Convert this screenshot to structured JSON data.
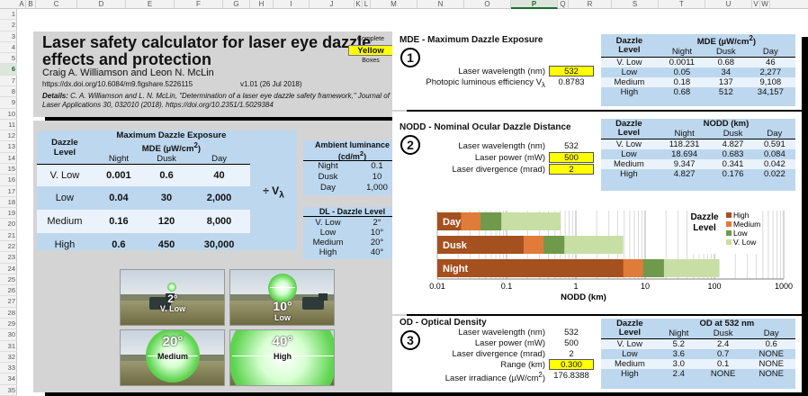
{
  "columns": [
    "A",
    "B",
    "C",
    "D",
    "E",
    "F",
    "G",
    "H",
    "I",
    "J",
    "K",
    "L",
    "M",
    "N",
    "O",
    "P",
    "Q",
    "R",
    "S",
    "T",
    "U",
    "V",
    "W"
  ],
  "selected_column": "P",
  "selected_row": "6",
  "rows": [
    "1",
    "2",
    "3",
    "4",
    "5",
    "6",
    "7",
    "8",
    "9",
    "10",
    "11",
    "12",
    "13",
    "14",
    "15",
    "16",
    "17",
    "18",
    "19",
    "20",
    "21",
    "22",
    "23",
    "24",
    "25",
    "26",
    "27",
    "28",
    "29",
    "30",
    "31",
    "32",
    "33",
    "34",
    "35"
  ],
  "header": {
    "title_line1": "Laser safety calculator for laser eye dazzle",
    "title_line2": "effects and protection",
    "authors": "Craig A. Williamson and Leon N. McLin",
    "doi": "https://dx.doi.org/10.6084/m9.figshare.5226115",
    "version": "v1.01 (26 Jul 2018)",
    "complete_label": "Complete",
    "yellow_label": "Yellow",
    "boxes_label": "Boxes",
    "details_label": "Details:",
    "details_text": " C. A. Williamson and L. N. McLin, \"Determination of a laser eye dazzle safety framework,\" Journal of Laser Applications 30, 032010 (2018). https://doi.org/10.2351/1.5029384"
  },
  "mde_table": {
    "col_dazzle": "Dazzle",
    "col_level": "Level",
    "title_line1": "Maximum Dazzle Exposure",
    "title_line2": "MDE (µW/cm",
    "title_sup": "2",
    "title_close": ")",
    "night": "Night",
    "dusk": "Dusk",
    "day": "Day",
    "rows": [
      {
        "level": "V. Low",
        "night": "0.001",
        "dusk": "0.6",
        "day": "40"
      },
      {
        "level": "Low",
        "night": "0.04",
        "dusk": "30",
        "day": "2,000"
      },
      {
        "level": "Medium",
        "night": "0.16",
        "dusk": "120",
        "day": "8,000"
      },
      {
        "level": "High",
        "night": "0.6",
        "dusk": "450",
        "day": "30,000"
      }
    ],
    "divide": "÷ V",
    "divide_sub": "λ"
  },
  "ambient": {
    "title": "Ambient luminance",
    "unit": "(cd/m",
    "unit_sup": "2",
    "unit_close": ")",
    "rows": [
      {
        "name": "Night",
        "value": "0.1"
      },
      {
        "name": "Dusk",
        "value": "10"
      },
      {
        "name": "Day",
        "value": "1,000"
      }
    ]
  },
  "dl": {
    "title": "DL - Dazzle Level",
    "rows": [
      {
        "name": "V. Low",
        "value": "2°"
      },
      {
        "name": "Low",
        "value": "10°"
      },
      {
        "name": "Medium",
        "value": "20°"
      },
      {
        "name": "High",
        "value": "40°"
      }
    ]
  },
  "photos": [
    {
      "angle": "2°",
      "level": "V. Low"
    },
    {
      "angle": "10°",
      "level": "Low"
    },
    {
      "angle": "20°",
      "level": "Medium"
    },
    {
      "angle": "40°",
      "level": "High"
    }
  ],
  "section1": {
    "number": "1",
    "title": "MDE - Maximum Dazzle Exposure",
    "wavelength_label": "Laser wavelength (nm)",
    "wavelength_value": "532",
    "efficiency_label": "Photopic luminous efficiency V",
    "efficiency_sub": "λ",
    "efficiency_value": "0.8783",
    "table": {
      "h_dazzle": "Dazzle",
      "h_level": "Level",
      "h_title": "MDE (µW/cm",
      "h_sup": "2",
      "h_close": ")",
      "night": "Night",
      "dusk": "Dusk",
      "day": "Day",
      "rows": [
        {
          "level": "V. Low",
          "night": "0.0011",
          "dusk": "0.68",
          "day": "46"
        },
        {
          "level": "Low",
          "night": "0.05",
          "dusk": "34",
          "day": "2,277"
        },
        {
          "level": "Medium",
          "night": "0.18",
          "dusk": "137",
          "day": "9,108"
        },
        {
          "level": "High",
          "night": "0.68",
          "dusk": "512",
          "day": "34,157"
        }
      ]
    }
  },
  "section2": {
    "number": "2",
    "title": "NODD - Nominal Ocular Dazzle Distance",
    "wavelength_label": "Laser wavelength (nm)",
    "wavelength_value": "532",
    "power_label": "Laser power (mW)",
    "power_value": "500",
    "divergence_label": "Laser divergence (mrad)",
    "divergence_value": "2",
    "table": {
      "h_dazzle": "Dazzle",
      "h_level": "Level",
      "h_title": "NODD (km)",
      "night": "Night",
      "dusk": "Dusk",
      "day": "Day",
      "rows": [
        {
          "level": "V. Low",
          "night": "118.231",
          "dusk": "4.827",
          "day": "0.591"
        },
        {
          "level": "Low",
          "night": "18.694",
          "dusk": "0.683",
          "day": "0.084"
        },
        {
          "level": "Medium",
          "night": "9.347",
          "dusk": "0.341",
          "day": "0.042"
        },
        {
          "level": "High",
          "night": "4.827",
          "dusk": "0.176",
          "day": "0.022"
        }
      ]
    }
  },
  "section3": {
    "number": "3",
    "title": "OD - Optical Density",
    "wavelength_label": "Laser wavelength (nm)",
    "wavelength_value": "532",
    "power_label": "Laser power (mW)",
    "power_value": "500",
    "divergence_label": "Laser divergence (mrad)",
    "divergence_value": "2",
    "range_label": "Range (km)",
    "range_value": "0.300",
    "irradiance_label": "Laser irradiance (µW/cm",
    "irradiance_sup": "2",
    "irradiance_close": ")",
    "irradiance_value": "176.8388",
    "table": {
      "h_dazzle": "Dazzle",
      "h_level": "Level",
      "h_title": "OD at 532 nm",
      "night": "Night",
      "dusk": "Dusk",
      "day": "Day",
      "rows": [
        {
          "level": "V. Low",
          "night": "5.2",
          "dusk": "2.4",
          "day": "0.6"
        },
        {
          "level": "Low",
          "night": "3.6",
          "dusk": "0.7",
          "day": "NONE"
        },
        {
          "level": "Medium",
          "night": "3.0",
          "dusk": "0.1",
          "day": "NONE"
        },
        {
          "level": "High",
          "night": "2.4",
          "dusk": "NONE",
          "day": "NONE"
        }
      ]
    }
  },
  "chart_data": {
    "type": "bar",
    "orientation": "horizontal",
    "stacked": true,
    "xscale": "log",
    "xlim": [
      0.01,
      1000
    ],
    "xticks": [
      "0.01",
      "0.1",
      "1",
      "10",
      "100",
      "1000"
    ],
    "xlabel": "NODD (km)",
    "legend_title_line1": "Dazzle",
    "legend_title_line2": "Level",
    "legend_placement": "right",
    "categories": [
      "Day",
      "Dusk",
      "Night"
    ],
    "series": [
      {
        "name": "High",
        "color": "#a5501f",
        "values": [
          0.022,
          0.176,
          4.827
        ]
      },
      {
        "name": "Medium",
        "color": "#e07b3a",
        "values": [
          0.042,
          0.341,
          9.347
        ]
      },
      {
        "name": "Low",
        "color": "#6f9a4c",
        "values": [
          0.084,
          0.683,
          18.694
        ]
      },
      {
        "name": "V. Low",
        "color": "#c7dfa5",
        "values": [
          0.591,
          4.827,
          118.231
        ]
      }
    ],
    "legend_order": [
      "High",
      "Medium",
      "Low",
      "V. Low"
    ]
  }
}
